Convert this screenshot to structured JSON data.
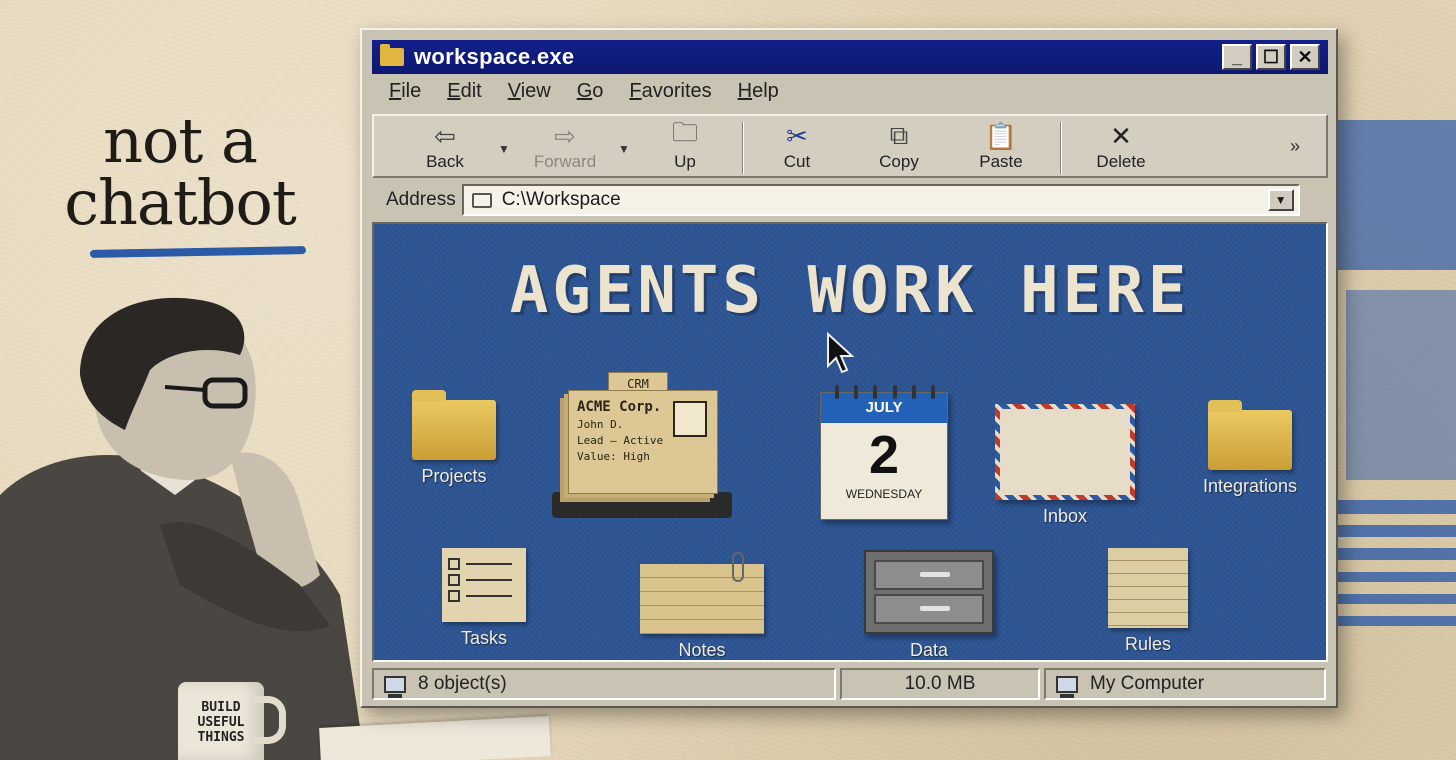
{
  "tagline": {
    "line1": "not a",
    "line2": "chatbot"
  },
  "mug": {
    "text": "BUILD USEFUL THINGS"
  },
  "window": {
    "title": "workspace.exe",
    "controls": [
      "_",
      "☐",
      "✕"
    ]
  },
  "menu": [
    "File",
    "Edit",
    "View",
    "Go",
    "Favorites",
    "Help"
  ],
  "toolbar": {
    "back": "Back",
    "forward": "Forward",
    "up": "Up",
    "cut": "Cut",
    "copy": "Copy",
    "paste": "Paste",
    "delete": "Delete",
    "more": "»"
  },
  "address": {
    "label": "Address",
    "value": "C:\\Workspace"
  },
  "desktop": {
    "headline": "AGENTS WORK HERE",
    "icons": {
      "projects": "Projects",
      "integrations": "Integrations",
      "inbox": "Inbox",
      "tasks": "Tasks",
      "notes": "Notes",
      "data": "Data",
      "rules": "Rules"
    },
    "crm": {
      "tab": "CRM",
      "company": "ACME Corp.",
      "contact": "John D.",
      "status": "Lead – Active",
      "value": "Value: High"
    },
    "calendar": {
      "month": "JULY",
      "day": "2",
      "weekday": "WEDNESDAY"
    }
  },
  "status": {
    "objects": "8 object(s)",
    "size": "10.0 MB",
    "location": "My Computer"
  },
  "colors": {
    "titlebar": "#13208a",
    "desktop": "#2d5594",
    "accent": "#2b5aa6"
  }
}
